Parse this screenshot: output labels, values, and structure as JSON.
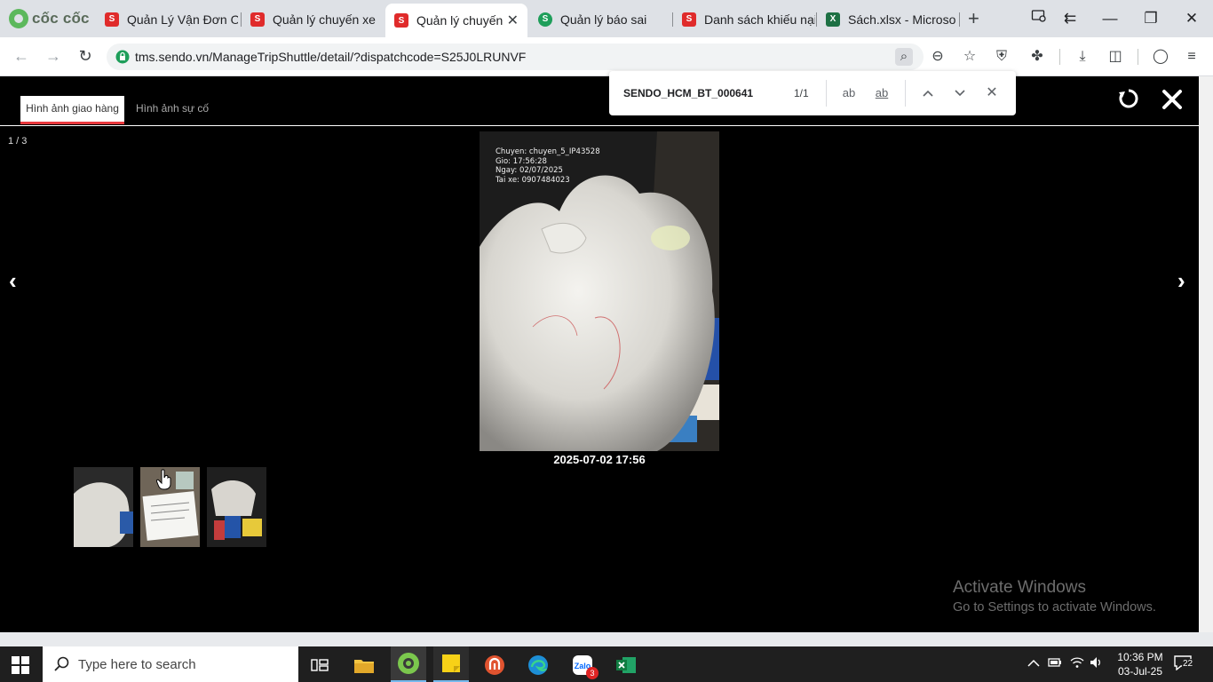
{
  "browser": {
    "brand": "cốc cốc",
    "tabs": [
      {
        "label": "Quản Lý Vận Đơn Or",
        "icon": "sendo-favicon-icon",
        "active": false
      },
      {
        "label": "Quản lý chuyến xe",
        "icon": "sendo-favicon-icon",
        "active": false
      },
      {
        "label": "Quản lý chuyến",
        "icon": "sendo-favicon-icon",
        "active": true
      },
      {
        "label": "Quản lý báo sai",
        "icon": "green-s-favicon-icon",
        "active": false
      },
      {
        "label": "Danh sách khiếu nại",
        "icon": "sendo-favicon-icon",
        "active": false
      },
      {
        "label": "Sách.xlsx - Microsoft",
        "icon": "excel-favicon-icon",
        "active": false
      }
    ],
    "url": "tms.sendo.vn/ManageTripShuttle/detail/?dispatchcode=S25J0LRUNVF"
  },
  "find_bar": {
    "query": "SENDO_HCM_BT_000641",
    "count": "1/1",
    "match_case": "ab",
    "whole_word": "ab"
  },
  "gallery": {
    "tabs": [
      "Hình ảnh giao hàng",
      "Hình ảnh sự cố"
    ],
    "counter": "1 / 3",
    "photo_stamp": [
      "Chuyen: chuyen_5_IP43528",
      "Gio: 17:56:28",
      "Ngay: 02/07/2025",
      "Tai xe: 0907484023"
    ],
    "caption": "2025-07-02 17:56",
    "thumbnails": 3,
    "prev": "‹",
    "next": "›"
  },
  "watermark": {
    "title": "Activate Windows",
    "subtitle": "Go to Settings to activate Windows."
  },
  "taskbar": {
    "search_placeholder": "Type here to search",
    "zalo_badge": "3",
    "time": "10:36 PM",
    "date": "03-Jul-25",
    "notifications": "22"
  }
}
